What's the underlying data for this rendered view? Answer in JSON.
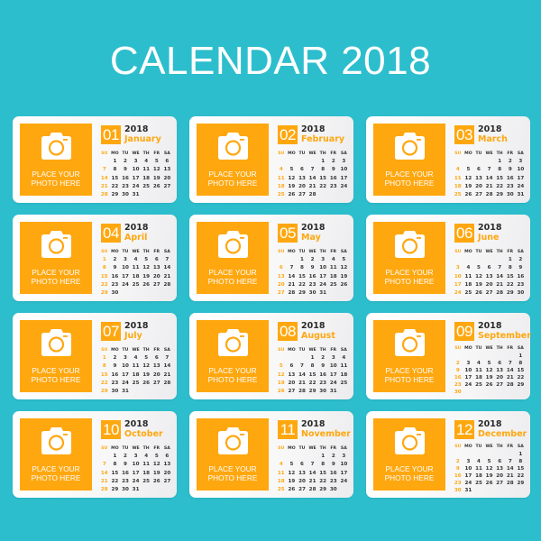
{
  "title": "CALENDAR 2018",
  "colors": {
    "background": "#2dbecd",
    "accent": "#ffa70f",
    "card": "#ffffff",
    "text": "#2a2a2a"
  },
  "photo_placeholder": {
    "icon": "camera-icon",
    "line1": "PLACE YOUR",
    "line2": "PHOTO HERE"
  },
  "weekdays": [
    "SU",
    "MO",
    "TU",
    "WE",
    "TH",
    "FR",
    "SA"
  ],
  "months": [
    {
      "num": "01",
      "name": "January",
      "year": "2018",
      "start": 1,
      "days": 31
    },
    {
      "num": "02",
      "name": "February",
      "year": "2018",
      "start": 4,
      "days": 28
    },
    {
      "num": "03",
      "name": "March",
      "year": "2018",
      "start": 4,
      "days": 31
    },
    {
      "num": "04",
      "name": "April",
      "year": "2018",
      "start": 0,
      "days": 30
    },
    {
      "num": "05",
      "name": "May",
      "year": "2018",
      "start": 2,
      "days": 31
    },
    {
      "num": "06",
      "name": "June",
      "year": "2018",
      "start": 5,
      "days": 30
    },
    {
      "num": "07",
      "name": "July",
      "year": "2018",
      "start": 0,
      "days": 31
    },
    {
      "num": "08",
      "name": "August",
      "year": "2018",
      "start": 3,
      "days": 31
    },
    {
      "num": "09",
      "name": "September",
      "year": "2018",
      "start": 6,
      "days": 30
    },
    {
      "num": "10",
      "name": "October",
      "year": "2018",
      "start": 1,
      "days": 31
    },
    {
      "num": "11",
      "name": "November",
      "year": "2018",
      "start": 4,
      "days": 30
    },
    {
      "num": "12",
      "name": "December",
      "year": "2018",
      "start": 6,
      "days": 31
    }
  ]
}
